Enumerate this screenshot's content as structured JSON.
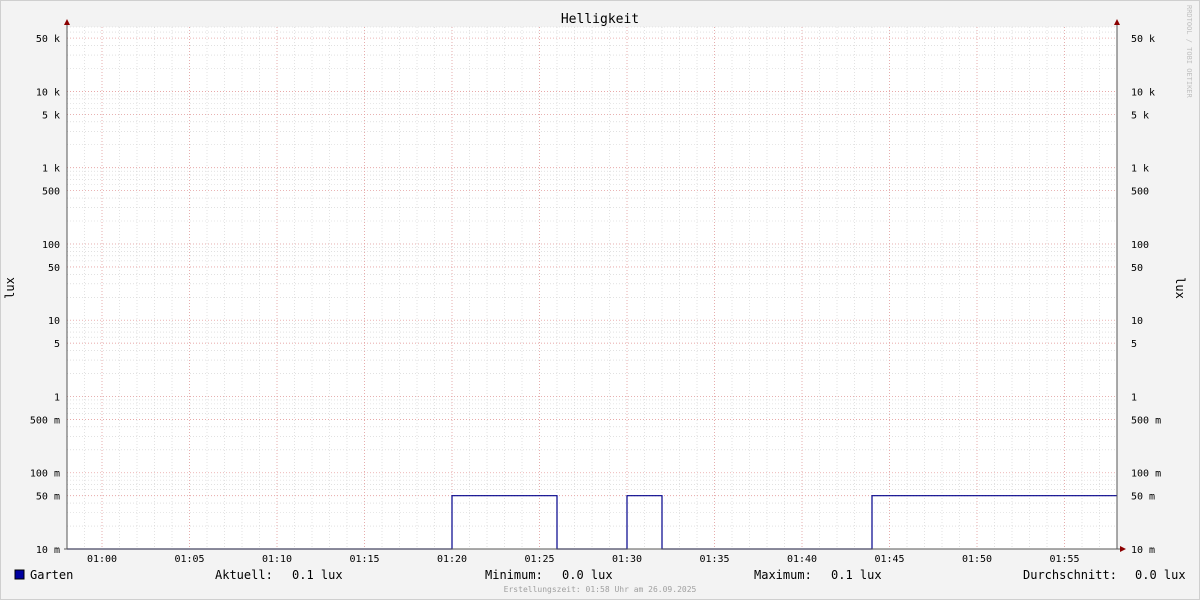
{
  "chart_data": {
    "type": "line",
    "title": "Helligkeit",
    "ylabel_left": "lux",
    "ylabel_right": "lux",
    "watermark": "RRDTOOL / TOBI OETIKER",
    "footer": "Erstellungszeit: 01:58 Uhr am 26.09.2025",
    "y_scale": "log",
    "ylim": [
      0.01,
      70000
    ],
    "y_ticks": [
      {
        "value": 50000,
        "label": "50 k"
      },
      {
        "value": 10000,
        "label": "10 k"
      },
      {
        "value": 5000,
        "label": "5 k"
      },
      {
        "value": 1000,
        "label": "1 k"
      },
      {
        "value": 500,
        "label": "500"
      },
      {
        "value": 100,
        "label": "100"
      },
      {
        "value": 50,
        "label": "50"
      },
      {
        "value": 10,
        "label": "10"
      },
      {
        "value": 5,
        "label": "5"
      },
      {
        "value": 1,
        "label": "1"
      },
      {
        "value": 0.5,
        "label": "500 m"
      },
      {
        "value": 0.1,
        "label": "100 m"
      },
      {
        "value": 0.05,
        "label": "50 m"
      },
      {
        "value": 0.01,
        "label": "10 m"
      }
    ],
    "xlim": [
      "00:58",
      "01:58"
    ],
    "x_ticks": [
      "01:00",
      "01:05",
      "01:10",
      "01:15",
      "01:20",
      "01:25",
      "01:30",
      "01:35",
      "01:40",
      "01:45",
      "01:50",
      "01:55"
    ],
    "grid": true,
    "series": [
      {
        "name": "Garten",
        "color": "#00008b",
        "points": [
          [
            "00:58",
            0.01
          ],
          [
            "01:20",
            0.01
          ],
          [
            "01:20",
            0.05
          ],
          [
            "01:26",
            0.05
          ],
          [
            "01:26",
            0.01
          ],
          [
            "01:30",
            0.01
          ],
          [
            "01:30",
            0.05
          ],
          [
            "01:32",
            0.05
          ],
          [
            "01:32",
            0.01
          ],
          [
            "01:44",
            0.01
          ],
          [
            "01:44",
            0.05
          ],
          [
            "01:58",
            0.05
          ]
        ]
      }
    ],
    "legend": {
      "swatch_color": "#0000a0",
      "label": "Garten",
      "stats": [
        {
          "label": "Aktuell:",
          "value": "0.1 lux"
        },
        {
          "label": "Minimum:",
          "value": "0.0 lux"
        },
        {
          "label": "Maximum:",
          "value": "0.1 lux"
        },
        {
          "label": "Durchschnitt:",
          "value": "0.0 lux"
        }
      ]
    },
    "colors": {
      "background": "#f3f3f3",
      "canvas": "#ffffff",
      "major_grid": "#e8a0a0",
      "minor_grid": "#cfcfcf",
      "axis": "#555555",
      "arrow": "#8b0000",
      "text": "#000000",
      "watermark": "#c0c0c0",
      "footer": "#a0a0a0"
    }
  }
}
